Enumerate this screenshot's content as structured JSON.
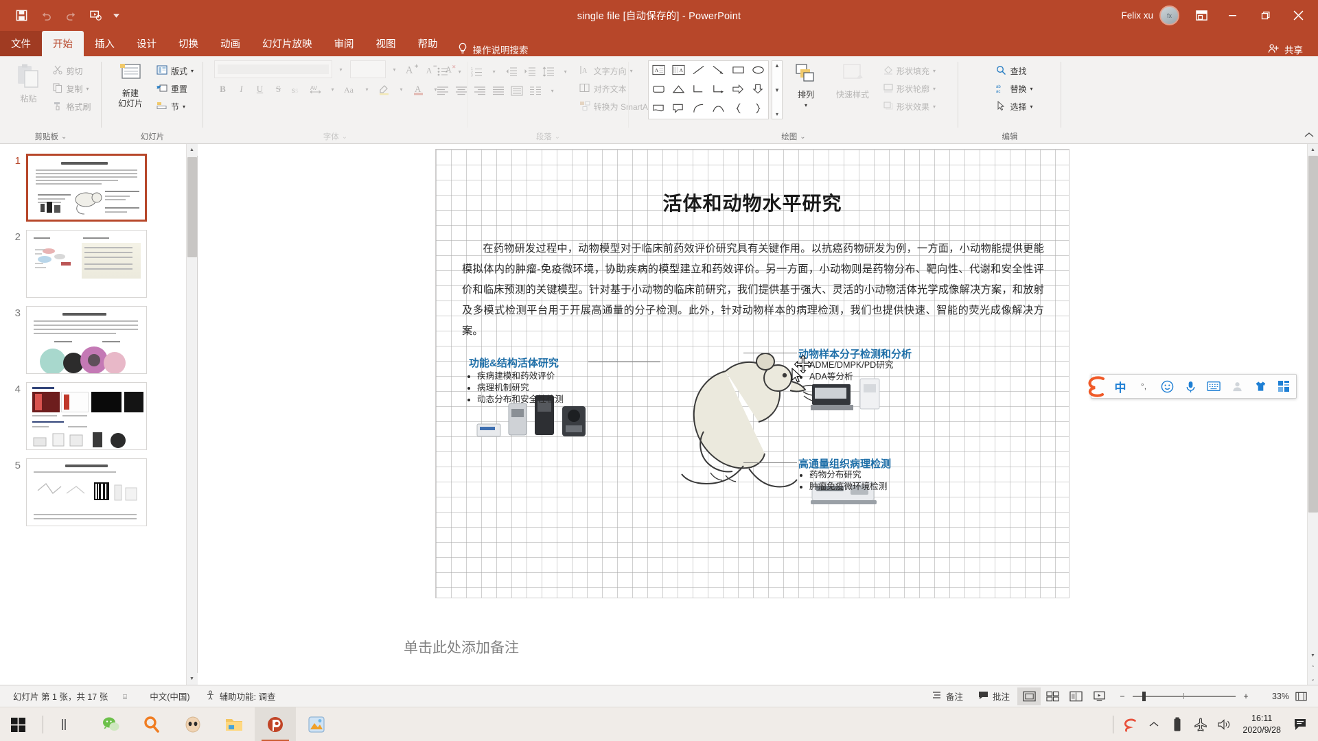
{
  "titlebar": {
    "document_title": "single file [自动保存的]  -  PowerPoint",
    "account_name": "Felix xu",
    "avatar_initials": "fx",
    "qat": [
      {
        "name": "save",
        "label": "保存"
      },
      {
        "name": "undo",
        "label": "撤消"
      },
      {
        "name": "redo",
        "label": "恢复"
      },
      {
        "name": "start-from-beginning",
        "label": "从头开始"
      },
      {
        "name": "customize-qat",
        "label": "自定义快速访问工具栏"
      }
    ],
    "window_buttons": {
      "ribbon_display": "功能区显示选项",
      "minimize": "最小化",
      "restore": "向下还原",
      "close": "关闭"
    }
  },
  "tabs": [
    {
      "label": "文件",
      "active": false,
      "file": true
    },
    {
      "label": "开始",
      "active": true,
      "file": false
    },
    {
      "label": "插入",
      "active": false,
      "file": false
    },
    {
      "label": "设计",
      "active": false,
      "file": false
    },
    {
      "label": "切换",
      "active": false,
      "file": false
    },
    {
      "label": "动画",
      "active": false,
      "file": false
    },
    {
      "label": "幻灯片放映",
      "active": false,
      "file": false
    },
    {
      "label": "审阅",
      "active": false,
      "file": false
    },
    {
      "label": "视图",
      "active": false,
      "file": false
    },
    {
      "label": "帮助",
      "active": false,
      "file": false
    }
  ],
  "tell_me": "操作说明搜索",
  "share_label": "共享",
  "ribbon": {
    "groups": [
      {
        "name": "clipboard",
        "label": "剪贴板",
        "big": {
          "label_line1": "粘贴",
          "label_line2": ""
        },
        "items": [
          {
            "label": "剪切"
          },
          {
            "label": "复制"
          },
          {
            "label": "格式刷"
          }
        ]
      },
      {
        "name": "slides",
        "label": "幻灯片",
        "big": {
          "label_line1": "新建",
          "label_line2": "幻灯片"
        },
        "items": [
          {
            "label": "版式"
          },
          {
            "label": "重置"
          },
          {
            "label": "节"
          }
        ]
      },
      {
        "name": "font",
        "label": "字体",
        "font_name": "",
        "font_size": "",
        "buttons": [
          "B",
          "I",
          "U",
          "S",
          "文字阴影",
          "字符间距",
          "更改大小写",
          "文本突出显示颜色",
          "字体颜色"
        ]
      },
      {
        "name": "paragraph",
        "label": "段落",
        "items": [
          {
            "label": "文字方向"
          },
          {
            "label": "对齐文本"
          },
          {
            "label": "转换为 SmartArt"
          }
        ]
      },
      {
        "name": "drawing",
        "label": "绘图",
        "arrange_label": "排列",
        "quick_styles_label": "快速样式",
        "items": [
          {
            "label": "形状填充"
          },
          {
            "label": "形状轮廓"
          },
          {
            "label": "形状效果"
          }
        ]
      },
      {
        "name": "editing",
        "label": "编辑",
        "items": [
          {
            "label": "查找"
          },
          {
            "label": "替换"
          },
          {
            "label": "选择"
          }
        ]
      }
    ]
  },
  "thumbnails": [
    {
      "num": "1",
      "selected": true
    },
    {
      "num": "2",
      "selected": false
    },
    {
      "num": "3",
      "selected": false
    },
    {
      "num": "4",
      "selected": false
    },
    {
      "num": "5",
      "selected": false
    }
  ],
  "slide": {
    "title": "活体和动物水平研究",
    "body": "在药物研发过程中，动物模型对于临床前药效评价研究具有关键作用。以抗癌药物研发为例，一方面，小动物能提供更能模拟体内的肿瘤-免疫微环境，协助疾病的模型建立和药效评价。另一方面，小动物则是药物分布、靶向性、代谢和安全性评价和临床预测的关键模型。针对基于小动物的临床前研究，我们提供基于强大、灵活的小动物活体光学成像解决方案，和放射及多模式检测平台用于开展高通量的分子检测。此外，针对动物样本的病理检测，我们也提供快速、智能的荧光成像解决方案。",
    "callouts": [
      {
        "name": "functional-structural",
        "heading": "功能&结构活体研究",
        "bullets": [
          "疾病建模和药效评价",
          "病理机制研究",
          "动态分布和安全性检测"
        ]
      },
      {
        "name": "molecular-detection",
        "heading": "动物样本分子检测和分析",
        "bullets": [
          "ADME/DMPK/PD研究",
          "ADA等分析"
        ]
      },
      {
        "name": "high-throughput-pathology",
        "heading": "高通量组织病理检测",
        "bullets": [
          "药物分布研究",
          "肿瘤免疫微环境检测"
        ]
      }
    ]
  },
  "notes_placeholder": "单击此处添加备注",
  "status": {
    "slide_count": "幻灯片 第 1 张，共 17 张",
    "language": "中文(中国)",
    "accessibility": "辅助功能: 调查",
    "notes_button": "备注",
    "comments_button": "批注",
    "views": [
      {
        "name": "normal-view",
        "active": true
      },
      {
        "name": "slide-sorter-view",
        "active": false
      },
      {
        "name": "reading-view",
        "active": false
      },
      {
        "name": "slideshow-view",
        "active": false
      }
    ],
    "zoom_out": "−",
    "zoom_in": "+",
    "zoom_level": "33%",
    "fit_to_window": "使幻灯片适应当前窗口"
  },
  "ime": {
    "name": "sogou-input-method",
    "mode_label": "中",
    "buttons": [
      {
        "name": "chinese-mode-icon",
        "label": "中"
      },
      {
        "name": "punctuation-icon",
        "label": "，"
      },
      {
        "name": "emoji-icon",
        "label": "☺"
      },
      {
        "name": "voice-input-icon",
        "label": "🎤"
      },
      {
        "name": "soft-keyboard-icon",
        "label": "⌨"
      },
      {
        "name": "user-center-icon",
        "label": "👤"
      },
      {
        "name": "skin-icon",
        "label": "👕"
      },
      {
        "name": "toolbox-icon",
        "label": "⊞"
      }
    ]
  },
  "taskbar": {
    "start": "开始",
    "task_view": "任务视图",
    "apps": [
      {
        "name": "wechat-icon"
      },
      {
        "name": "search-icon"
      },
      {
        "name": "browser-icon"
      },
      {
        "name": "file-explorer-icon"
      },
      {
        "name": "powerpoint-icon",
        "active": true
      },
      {
        "name": "photo-editor-icon",
        "active": false
      }
    ],
    "tray": [
      {
        "name": "sogou-tray-icon"
      },
      {
        "name": "show-hidden-icons"
      },
      {
        "name": "battery-icon"
      },
      {
        "name": "airplane-mode-icon"
      },
      {
        "name": "volume-icon"
      }
    ],
    "time": "16:11",
    "date": "2020/9/28",
    "notifications": "通知"
  }
}
